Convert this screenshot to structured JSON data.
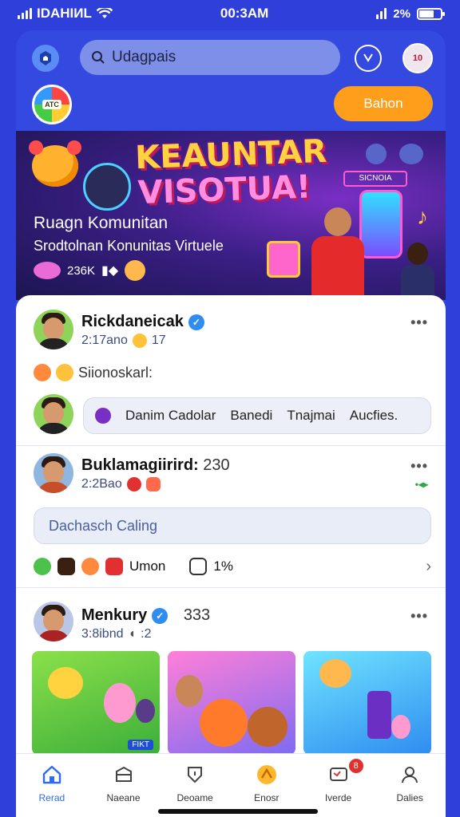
{
  "status_bar": {
    "carrier": "IDAHIИL",
    "time": "00:3AM",
    "battery_text": "2%"
  },
  "top_bar": {
    "search_text": "Udagpais",
    "profile_badge": "10"
  },
  "header": {
    "group_badge": "ATC",
    "action_button": "Bahon"
  },
  "banner": {
    "title_line1": "KEAUNTAR",
    "title_line2": "VISOTUA!",
    "heading": "Ruagn Komunitan",
    "subheading": "Srodtolnan Konunitas Virtuele",
    "stat_count": "236K",
    "sign_text": "SICNOIA"
  },
  "posts": [
    {
      "name": "Rickdaneicak",
      "meta": "2:17ano",
      "meta_count": "17",
      "reaction_text": "Siionoskarl:",
      "chips": [
        "Danim Cadolar",
        "Banedi",
        "Tnajmai",
        "Aucfies."
      ]
    },
    {
      "name": "Buklamagiirird:",
      "name_suffix": "230",
      "meta": "2:2Bao",
      "comment_placeholder": "Dachasch Caling",
      "action_label": "Umon",
      "action_count": "1%"
    },
    {
      "name": "Menkury",
      "name_suffix": "333",
      "meta": "3:8ibnd",
      "meta_count": ":2",
      "tile_badge": "FIKT"
    }
  ],
  "bottom_nav": {
    "items": [
      {
        "label": "Rerad",
        "icon": "home-icon"
      },
      {
        "label": "Naeane",
        "icon": "box-icon"
      },
      {
        "label": "Deoame",
        "icon": "shield-icon"
      },
      {
        "label": "Enosr",
        "icon": "award-icon"
      },
      {
        "label": "Iverde",
        "icon": "chat-icon"
      },
      {
        "label": "Dalies",
        "icon": "user-icon"
      }
    ],
    "notification_count": "8"
  },
  "colors": {
    "accent": "#3449e0",
    "action": "#ff9e1b",
    "active": "#2f6bf0"
  }
}
